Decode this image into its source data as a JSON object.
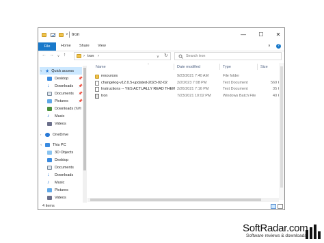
{
  "window": {
    "title": "tron"
  },
  "titlebar": {
    "minimize": "—",
    "maximize": "☐",
    "close": "✕",
    "qat_arrow": "∨"
  },
  "ribbon": {
    "file": "File",
    "tabs": [
      "Home",
      "Share",
      "View"
    ],
    "expand": "∨",
    "help": "?"
  },
  "nav": {
    "back": "←",
    "forward": "→",
    "recent": "∨",
    "up": "↑",
    "breadcrumb_sep": "›",
    "path": [
      "tron"
    ],
    "dropdown": "∨",
    "refresh": "↻",
    "search_placeholder": "Search tron"
  },
  "sidebar": {
    "quick_access": {
      "label": "Quick access",
      "items": [
        {
          "label": "Desktop",
          "icon": "desktop-icon",
          "pinned": true
        },
        {
          "label": "Downloads",
          "icon": "downloads-icon",
          "pinned": true
        },
        {
          "label": "Documents",
          "icon": "documents-icon",
          "pinned": true
        },
        {
          "label": "Pictures",
          "icon": "pictures-icon",
          "pinned": true
        },
        {
          "label": "Downloads (\\\\VI",
          "icon": "network-drive-icon",
          "pinned": false
        },
        {
          "label": "Music",
          "icon": "music-icon",
          "pinned": false
        },
        {
          "label": "Videos",
          "icon": "videos-icon",
          "pinned": false
        }
      ]
    },
    "onedrive": {
      "label": "OneDrive"
    },
    "this_pc": {
      "label": "This PC",
      "items": [
        {
          "label": "3D Objects",
          "icon": "3d-objects-icon"
        },
        {
          "label": "Desktop",
          "icon": "desktop-icon"
        },
        {
          "label": "Documents",
          "icon": "documents-icon"
        },
        {
          "label": "Downloads",
          "icon": "downloads-icon"
        },
        {
          "label": "Music",
          "icon": "music-icon"
        },
        {
          "label": "Pictures",
          "icon": "pictures-icon"
        },
        {
          "label": "Videos",
          "icon": "videos-icon"
        }
      ]
    },
    "pin_glyph": "📌"
  },
  "columns": {
    "name": "Name",
    "date": "Date modified",
    "type": "Type",
    "size": "Size",
    "sort_arrow": "^"
  },
  "files": [
    {
      "name": "resources",
      "date": "9/23/2021 7:40 AM",
      "type": "File folder",
      "size": "",
      "icon": "folder-icon"
    },
    {
      "name": "changelog-v12.0.5-updated-2023-02-02",
      "date": "2/2/2023 7:08 PM",
      "type": "Text Document",
      "size": "569 KB",
      "icon": "text-file-icon"
    },
    {
      "name": "Instructions -- YES ACTUALLY READ THEM",
      "date": "2/26/2021 7:16 PM",
      "type": "Text Document",
      "size": "35 KB",
      "icon": "text-file-icon"
    },
    {
      "name": "tron",
      "date": "7/23/2021 10:02 PM",
      "type": "Windows Batch File",
      "size": "40 KB",
      "icon": "batch-file-icon"
    }
  ],
  "status": {
    "count": "4 items"
  },
  "watermark": {
    "brand": "SoftRadar.com",
    "tagline": "Software reviews & downloads"
  },
  "colors": {
    "accent": "#1979ca",
    "folder": "#f0c24b",
    "selected": "#cce8ff"
  }
}
